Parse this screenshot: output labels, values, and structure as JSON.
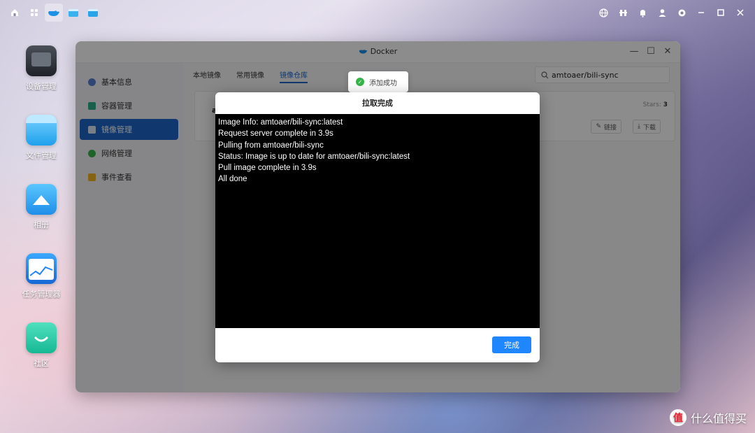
{
  "taskbar": {
    "left_icons": [
      "home-icon",
      "apps-grid-icon",
      "docker-icon",
      "folder-window-icon",
      "files-window-icon"
    ],
    "right_icons": [
      "globe-icon",
      "brightness-icon",
      "bell-icon",
      "user-icon",
      "settings-icon",
      "minimize-icon",
      "maximize-icon",
      "close-icon"
    ]
  },
  "desktop": {
    "icons": [
      {
        "label": "设备管理"
      },
      {
        "label": "文件管理"
      },
      {
        "label": "相册"
      },
      {
        "label": "任务管理器"
      },
      {
        "label": "社区"
      }
    ]
  },
  "window": {
    "title": "Docker",
    "sidebar": [
      {
        "label": "基本信息"
      },
      {
        "label": "容器管理"
      },
      {
        "label": "镜像管理"
      },
      {
        "label": "网络管理"
      },
      {
        "label": "事件查看"
      }
    ],
    "tabs": [
      {
        "label": "本地镜像"
      },
      {
        "label": "常用镜像"
      },
      {
        "label": "镜像仓库"
      }
    ],
    "search_value": "amtoaer/bili-sync",
    "card": {
      "title_partial": "a",
      "stars_label": "Stars",
      "stars_value": "3",
      "link_label": "链接",
      "download_label": "下载"
    }
  },
  "toast": {
    "message": "添加成功"
  },
  "dialog": {
    "title": "拉取完成",
    "log_lines": [
      "Image Info: amtoaer/bili-sync:latest",
      "Request server complete in 3.9s",
      "Pulling from amtoaer/bili-sync",
      "Status: Image is up to date for amtoaer/bili-sync:latest",
      "Pull image complete in 3.9s",
      "All done"
    ],
    "done_label": "完成"
  },
  "watermark": {
    "logo_text": "值",
    "text": "什么值得买"
  },
  "colors": {
    "accent": "#1e67c9",
    "button": "#1e86ff",
    "success": "#35b64a",
    "terminal_bg": "#000000"
  }
}
